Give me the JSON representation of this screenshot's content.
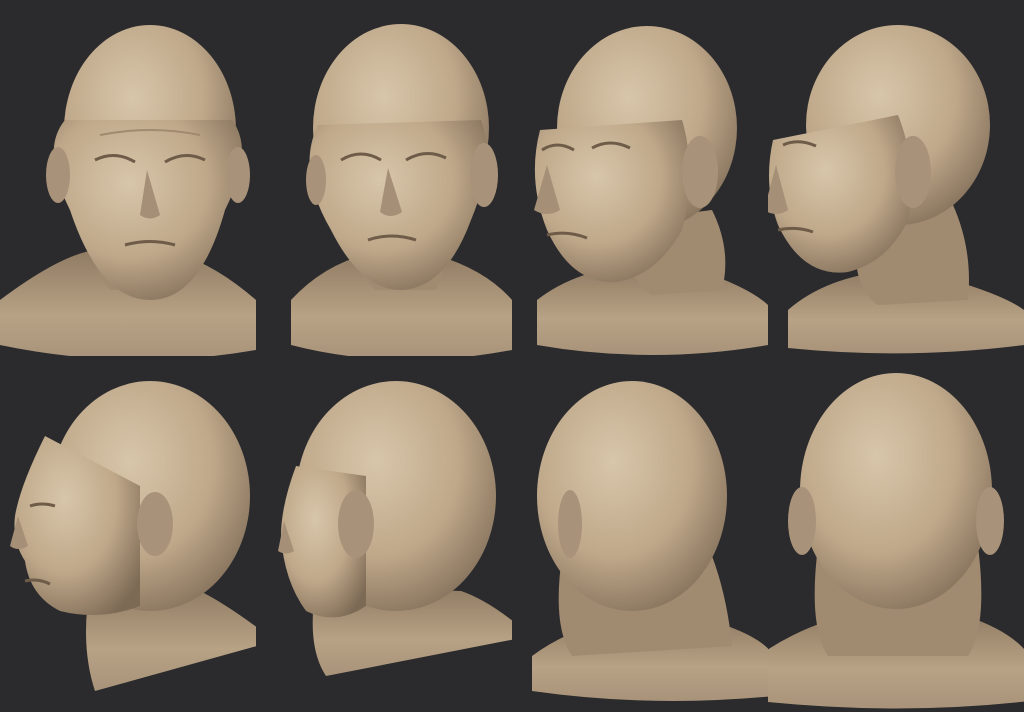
{
  "background_color": "#2b2b2d",
  "clay_color": "#bfa88a",
  "clay_shadow_color": "#7d6a55",
  "clay_highlight_color": "#d8c6aa",
  "views": [
    {
      "name": "front",
      "icon": "sculpt-head-front"
    },
    {
      "name": "front-three-quarter-right",
      "icon": "sculpt-head-front-34"
    },
    {
      "name": "three-quarter-left",
      "icon": "sculpt-head-34"
    },
    {
      "name": "profile-three-quarter-left",
      "icon": "sculpt-head-near-profile"
    },
    {
      "name": "profile-left",
      "icon": "sculpt-head-profile"
    },
    {
      "name": "rear-three-quarter-left",
      "icon": "sculpt-head-rear-34"
    },
    {
      "name": "rear-left",
      "icon": "sculpt-head-rear-near"
    },
    {
      "name": "rear",
      "icon": "sculpt-head-back"
    }
  ]
}
